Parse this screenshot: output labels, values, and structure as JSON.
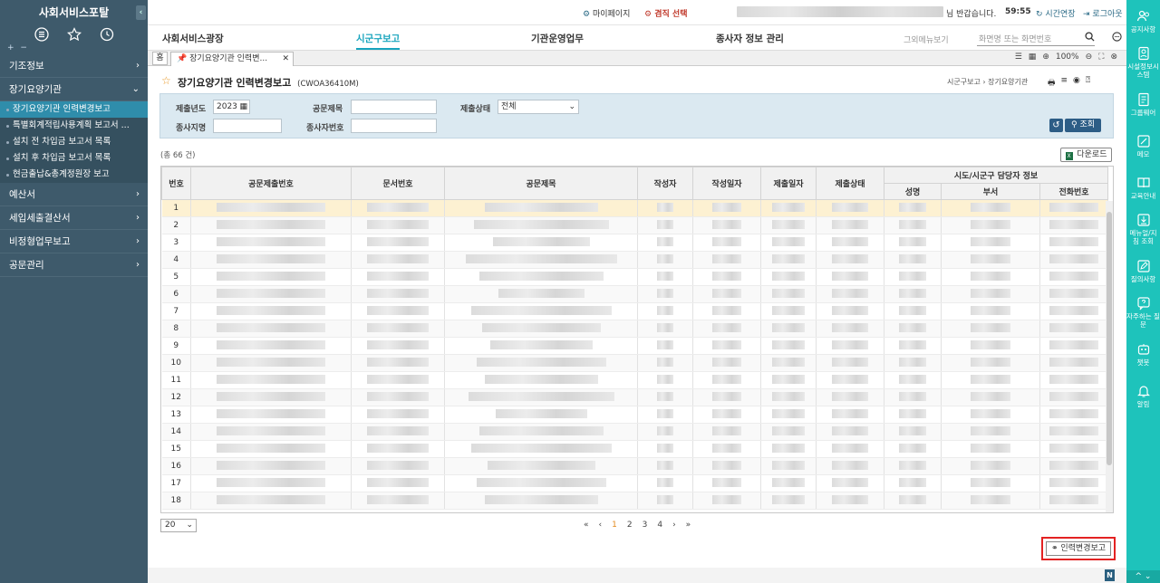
{
  "sidebar": {
    "title": "사회서비스포탈",
    "collapse_glyph": "‹",
    "pm": "+ −",
    "menus": [
      {
        "label": "기조정보",
        "chev": "›"
      },
      {
        "label": "장기요양기관",
        "chev": "⌄"
      }
    ],
    "subitems": [
      {
        "label": "장기요양기관 인력변경보고"
      },
      {
        "label": "특별회계적립사용계획 보고서 ..."
      },
      {
        "label": "설치 전 차입금 보고서 목록"
      },
      {
        "label": "설치 후 차입금 보고서 목록"
      },
      {
        "label": "현금출납&총계정원장 보고"
      }
    ],
    "menus_after": [
      {
        "label": "예산서",
        "chev": "›"
      },
      {
        "label": "세입세출결산서",
        "chev": "›"
      },
      {
        "label": "비정형업무보고",
        "chev": "›"
      },
      {
        "label": "공문관리",
        "chev": "›"
      }
    ]
  },
  "topbar": {
    "mypage": "마이페이지",
    "role_select": "겸직 선택",
    "welcome": "님 반갑습니다.",
    "timer": "59:55",
    "extend": "시간연장",
    "logout": "로그아웃"
  },
  "nav": {
    "items": [
      "사회서비스광장",
      "시군구보고",
      "기관운영업무",
      "종사자 정보 관리"
    ],
    "other_menu": "그외메뉴보기",
    "search_placeholder": "화면명 또는 화면번호"
  },
  "tabs": {
    "home": "홈",
    "current": "장기요양기관 인력변...",
    "close": "✕",
    "zoom": "100%"
  },
  "page": {
    "title": "장기요양기관 인력변경보고",
    "code": "(CWOA36410M)",
    "breadcrumb": "시군구보고  ›  장기요양기관"
  },
  "filter": {
    "year_label": "제출년도",
    "year_value": "2023",
    "doc_title_label": "공문제목",
    "status_label": "제출상태",
    "status_value": "전체",
    "branch_label": "종사지명",
    "worker_no_label": "종사자번호",
    "search_btn": "조회"
  },
  "list": {
    "total": "(총 66 건)",
    "download": "다운로드"
  },
  "grid": {
    "headers": [
      "번호",
      "공문제출번호",
      "문서번호",
      "공문제목",
      "작성자",
      "작성일자",
      "제출일자",
      "제출상태",
      "시도/시군구 담당자 정보"
    ],
    "sub_headers": [
      "성명",
      "부서",
      "전화번호"
    ],
    "row_numbers": [
      "1",
      "2",
      "3",
      "4",
      "5",
      "6",
      "7",
      "8",
      "9",
      "10",
      "11",
      "12",
      "13",
      "14",
      "15",
      "16",
      "17",
      "18"
    ]
  },
  "pagination": {
    "page_size": "20",
    "first": "«",
    "prev": "‹",
    "pages": [
      "1",
      "2",
      "3",
      "4"
    ],
    "next": "›",
    "last": "»"
  },
  "actions": {
    "report_btn": "인력변경보고"
  },
  "rightbar": {
    "items": [
      "공지사항",
      "시설정보시스템",
      "그룹웨어",
      "메모",
      "교육안내",
      "메뉴얼/지침 조회",
      "질의사항",
      "자주하는 질문",
      "챗봇",
      "알림"
    ],
    "bottom": "^  ⌄"
  },
  "badge": "N"
}
